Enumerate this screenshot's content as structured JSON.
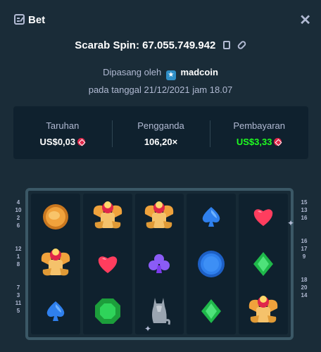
{
  "header": {
    "title": "Bet",
    "close_label": "✕"
  },
  "game": {
    "line": "Scarab Spin: 67.055.749.942"
  },
  "placed": {
    "prefix": "Dipasang oleh",
    "user": "madcoin",
    "date": "pada tanggal 21/12/2021 jam 18.07"
  },
  "stats": [
    {
      "label": "Taruhan",
      "value": "US$0,03",
      "coin": true,
      "win": false
    },
    {
      "label": "Pengganda",
      "value": "106,20×",
      "coin": false,
      "win": false
    },
    {
      "label": "Pembayaran",
      "value": "US$3,33",
      "coin": true,
      "win": true
    }
  ],
  "paylines": {
    "left": [
      "4",
      "10",
      "2",
      "6",
      "",
      "",
      "12",
      "1",
      "8",
      "",
      "",
      "7",
      "3",
      "11",
      "5"
    ],
    "right": [
      "15",
      "13",
      "16",
      "",
      "",
      "16",
      "17",
      "9",
      "",
      "",
      "18",
      "20",
      "14",
      ""
    ]
  },
  "reels": [
    [
      "coin-gold",
      "scarab",
      "spade-blue"
    ],
    [
      "scarab",
      "heart-red",
      "emerald"
    ],
    [
      "scarab",
      "club-purple",
      "cat-statue"
    ],
    [
      "spade-blue",
      "coin-blue",
      "diamond-green"
    ],
    [
      "heart-red",
      "diamond-green",
      "scarab"
    ]
  ],
  "colors": {
    "win": "#1fff20",
    "bg": "#1a2c38",
    "panel": "#0f212e"
  }
}
